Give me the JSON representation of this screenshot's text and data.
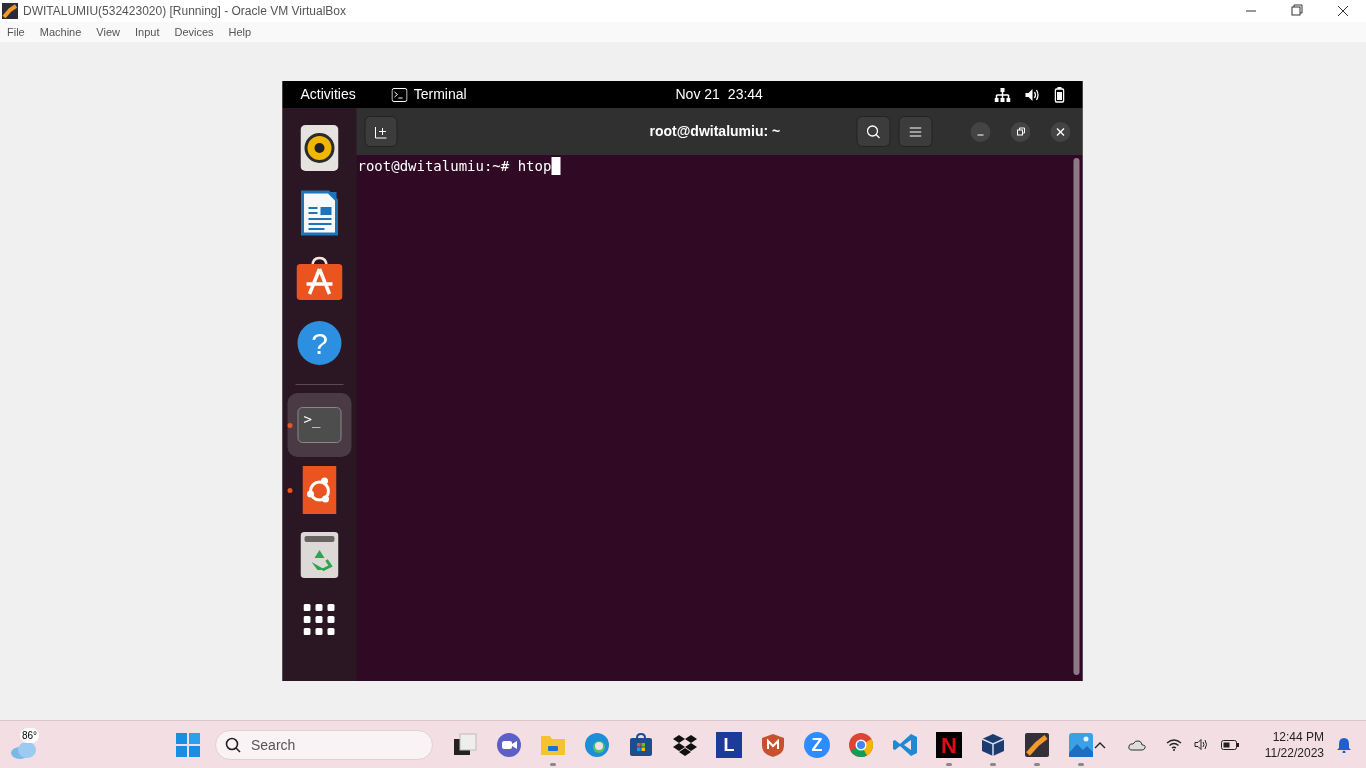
{
  "window": {
    "title": "DWITALUMIU(532423020) [Running] - Oracle VM VirtualBox"
  },
  "menu": [
    "File",
    "Machine",
    "View",
    "Input",
    "Devices",
    "Help"
  ],
  "guest": {
    "top_bar": {
      "activities": "Activities",
      "app": "Terminal",
      "date": "Nov 21",
      "time": "23:44"
    },
    "dock": [
      {
        "kind": "speaker",
        "running": false,
        "selected": false
      },
      {
        "kind": "writer",
        "running": false,
        "selected": false
      },
      {
        "kind": "appstore",
        "running": false,
        "selected": false
      },
      {
        "kind": "help",
        "label": "?",
        "running": false,
        "selected": false
      },
      {
        "kind": "separator"
      },
      {
        "kind": "terminal",
        "label": ">_",
        "running": true,
        "selected": true
      },
      {
        "kind": "ubuntu",
        "running": true,
        "selected": false
      },
      {
        "kind": "trash",
        "running": false,
        "selected": false
      },
      {
        "kind": "grid",
        "running": false,
        "selected": false
      }
    ],
    "terminal": {
      "title": "root@dwitalumiu: ~",
      "prompt": "root@dwitalumiu:~# ",
      "command": "htop"
    }
  },
  "taskbar": {
    "weather": "86°",
    "search": {
      "placeholder": "Search"
    },
    "apps": [
      {
        "kind": "taskview",
        "running": false
      },
      {
        "kind": "meet",
        "running": false
      },
      {
        "kind": "files",
        "running": true
      },
      {
        "kind": "edge",
        "running": false
      },
      {
        "kind": "store",
        "running": false
      },
      {
        "kind": "dropbox",
        "running": false
      },
      {
        "kind": "letter",
        "label": "L",
        "running": false
      },
      {
        "kind": "shield",
        "running": false
      },
      {
        "kind": "zoom",
        "label": "Z",
        "running": false
      },
      {
        "kind": "chrome",
        "running": false
      },
      {
        "kind": "vscode",
        "running": false
      },
      {
        "kind": "netflix",
        "label": "N",
        "running": true
      },
      {
        "kind": "vbox",
        "running": true
      },
      {
        "kind": "g4",
        "running": true
      },
      {
        "kind": "photos",
        "running": true
      }
    ],
    "time": "12:44 PM",
    "date": "11/22/2023"
  }
}
